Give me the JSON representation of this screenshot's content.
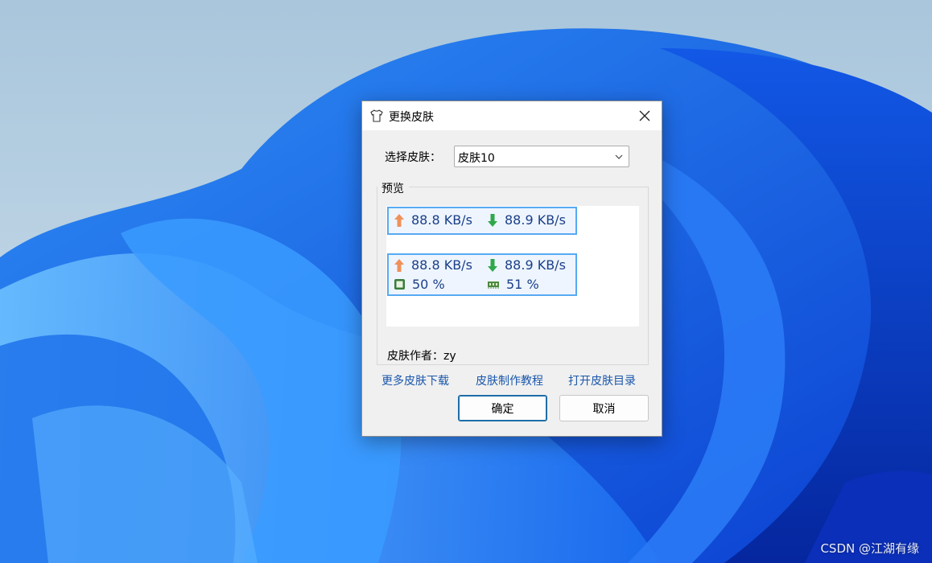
{
  "desktop": {
    "watermark": "CSDN @江湖有缘"
  },
  "dialog": {
    "title": "更换皮肤",
    "icon": "tshirt-icon",
    "close_icon": "close-icon",
    "skin_select": {
      "label": "选择皮肤：",
      "value": "皮肤10"
    },
    "preview": {
      "legend": "预览",
      "widget1": {
        "upload": "88.8 KB/s",
        "download": "88.9 KB/s"
      },
      "widget2": {
        "upload": "88.8 KB/s",
        "download": "88.9 KB/s",
        "cpu": "50 %",
        "memory": "51 %"
      }
    },
    "author": "皮肤作者：zy",
    "links": {
      "more_skins": "更多皮肤下载",
      "tutorial": "皮肤制作教程",
      "open_dir": "打开皮肤目录"
    },
    "buttons": {
      "ok": "确定",
      "cancel": "取消"
    },
    "colors": {
      "accent_text": "#1a3f88",
      "widget_border": "#57aaf2",
      "upload_arrow": "#f0915a",
      "download_arrow": "#2fa84a",
      "link": "#1a57ab"
    }
  }
}
